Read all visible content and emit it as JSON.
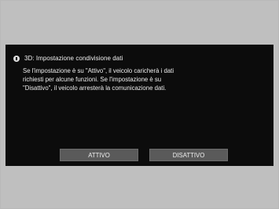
{
  "dialog": {
    "title": "3D: Impostazione condivisione dati",
    "body_lines": [
      "Se l'impostazione è su \"Attivo\", il veicolo caricherà i dati",
      "richiesti per alcune funzioni. Se l'impostazione è su",
      "\"Disattivo\", il veicolo arresterà la comunicazione dati."
    ],
    "buttons": {
      "on_label": "ATTIVO",
      "off_label": "DISATTIVO"
    }
  },
  "icons": {
    "info": "info-icon"
  }
}
